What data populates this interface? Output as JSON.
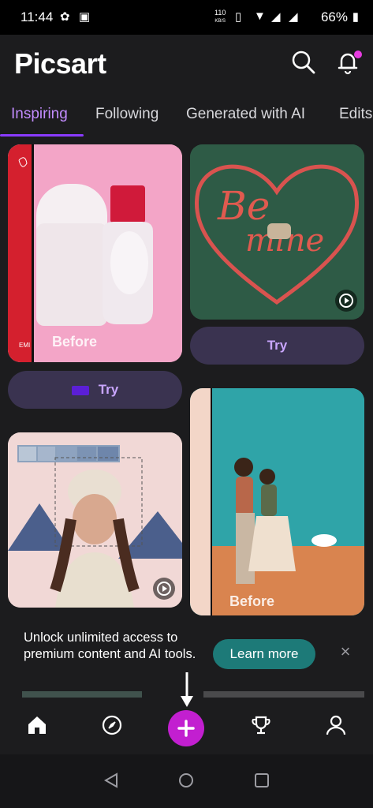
{
  "status_bar": {
    "time": "11:44",
    "net_speed_top": "110",
    "net_speed_unit": "KB/S",
    "battery": "66%"
  },
  "header": {
    "logo": "Picsart",
    "search_icon": "search-icon",
    "notification_icon": "bell-icon"
  },
  "tabs": [
    {
      "label": "Inspiring",
      "active": true
    },
    {
      "label": "Following"
    },
    {
      "label": "Generated with AI"
    },
    {
      "label": "Edits"
    }
  ],
  "feed": {
    "card1": {
      "overlay": "Before",
      "watermark": "EMI",
      "try_label": "Try"
    },
    "card2": {
      "art_text_1": "Be",
      "art_text_2": "mine",
      "try_label": "Try"
    },
    "card4": {
      "overlay": "Before"
    }
  },
  "banner": {
    "text": "Unlock unlimited access to premium content and AI tools.",
    "button": "Learn more",
    "close": "×"
  },
  "bottom_nav": [
    "home-icon",
    "explore-icon",
    "create-plus-icon",
    "trophy-icon",
    "profile-icon"
  ],
  "colors": {
    "accent": "#c21fd0",
    "tab_active": "#c38cff",
    "try_button": "#3a3350",
    "learn_button": "#1d7a78"
  }
}
